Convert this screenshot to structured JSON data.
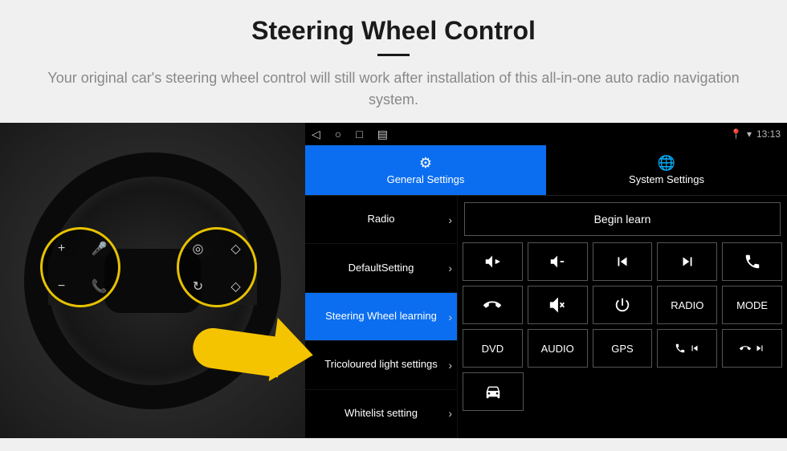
{
  "hero": {
    "title": "Steering Wheel Control",
    "subtitle": "Your original car's steering wheel control will still work after installation of this all-in-one auto radio navigation system."
  },
  "statusbar": {
    "time": "13:13"
  },
  "tabs": {
    "general": "General Settings",
    "system": "System Settings"
  },
  "sidebar": {
    "items": [
      {
        "label": "Radio"
      },
      {
        "label": "DefaultSetting"
      },
      {
        "label": "Steering Wheel learning"
      },
      {
        "label": "Tricoloured light settings"
      },
      {
        "label": "Whitelist setting"
      }
    ]
  },
  "panel": {
    "begin": "Begin learn",
    "row1": {
      "b3": "",
      "b4": ""
    },
    "row2": {
      "b4": "RADIO",
      "b5": "MODE"
    },
    "row3": {
      "b1": "DVD",
      "b2": "AUDIO",
      "b3": "GPS"
    }
  }
}
